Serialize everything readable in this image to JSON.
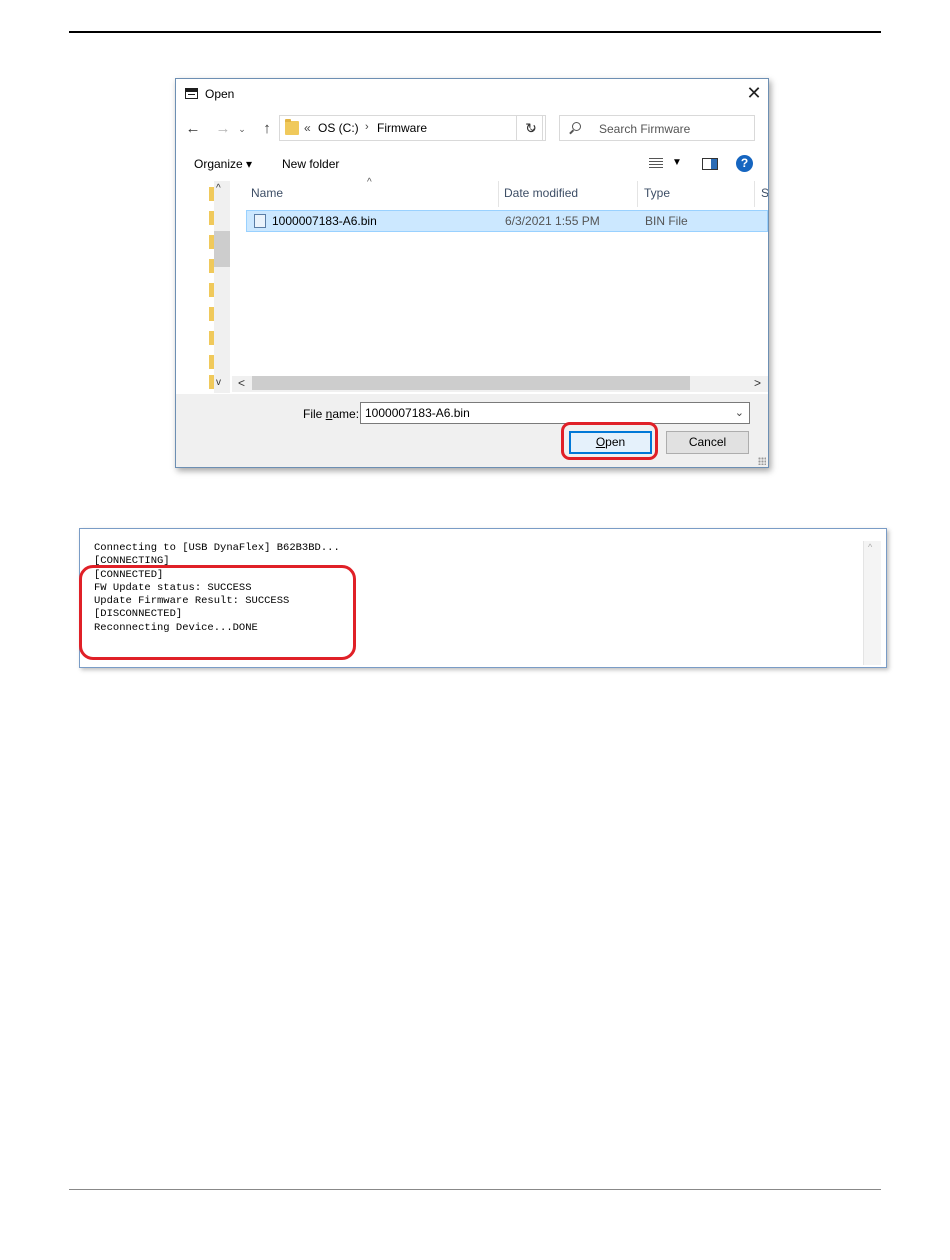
{
  "dialog": {
    "title": "Open",
    "close_glyph": "✕",
    "nav": {
      "back_glyph": "←",
      "forward_glyph": "→",
      "recent_glyph": "⌄",
      "up_glyph": "↑"
    },
    "breadcrumb": {
      "chevron": "«",
      "drive": "OS (C:)",
      "separator": "›",
      "folder": "Firmware",
      "dropdown_glyph": "⌄"
    },
    "refresh_glyph": "↻",
    "search_placeholder": "Search Firmware",
    "toolbar": {
      "organize": "Organize ▾",
      "new_folder": "New folder",
      "view_dropdown": "▼",
      "help": "?"
    },
    "columns": {
      "name": "Name",
      "date": "Date modified",
      "type": "Type",
      "size": "S"
    },
    "sort_caret": "^",
    "files": [
      {
        "name": "1000007183-A6.bin",
        "date": "6/3/2021 1:55 PM",
        "type": "BIN File"
      }
    ],
    "scroll": {
      "up": "^",
      "down": "v",
      "left": "<",
      "right": ">"
    },
    "file_name_label_pre": "File ",
    "file_name_label_key": "n",
    "file_name_label_post": "ame:",
    "file_name_value": "1000007183-A6.bin",
    "file_name_dropdown": "⌄",
    "open_key": "O",
    "open_rest": "pen",
    "cancel_label": "Cancel"
  },
  "console": {
    "lines": "Connecting to [USB DynaFlex] B62B3BD...\n[CONNECTING]\n[CONNECTED]\nFW Update status: SUCCESS\nUpdate Firmware Result: SUCCESS\n[DISCONNECTED]\nReconnecting Device...DONE",
    "scroll_up": "^"
  },
  "colors": {
    "highlight": "#e02027",
    "selection": "#cce8ff",
    "accent": "#0078d7"
  }
}
